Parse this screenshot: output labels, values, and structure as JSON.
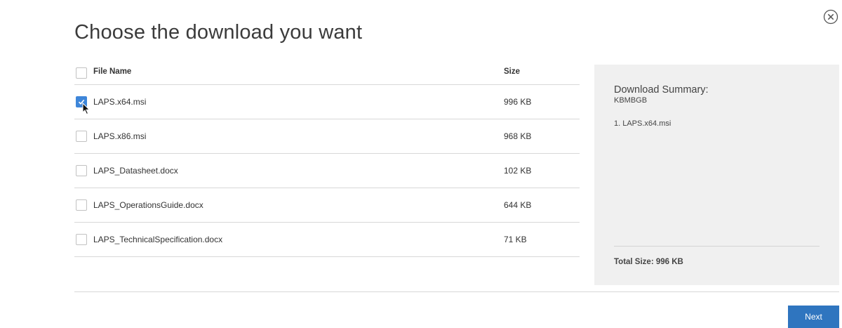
{
  "dialog": {
    "title": "Choose the download you want"
  },
  "table": {
    "columns": {
      "name": "File Name",
      "size": "Size"
    },
    "rows": [
      {
        "name": "LAPS.x64.msi",
        "size": "996 KB",
        "checked": true
      },
      {
        "name": "LAPS.x86.msi",
        "size": "968 KB",
        "checked": false
      },
      {
        "name": "LAPS_Datasheet.docx",
        "size": "102 KB",
        "checked": false
      },
      {
        "name": "LAPS_OperationsGuide.docx",
        "size": "644 KB",
        "checked": false
      },
      {
        "name": "LAPS_TechnicalSpecification.docx",
        "size": "71 KB",
        "checked": false
      }
    ]
  },
  "summary": {
    "title": "Download Summary:",
    "subtitle": "KBMBGB",
    "items": [
      "1. LAPS.x64.msi"
    ],
    "total": "Total Size: 996 KB"
  },
  "actions": {
    "next_label": "Next"
  },
  "colors": {
    "accent": "#2f75bf",
    "checkbox_checked": "#3e86d9",
    "summary_bg": "#f0f0f0"
  }
}
